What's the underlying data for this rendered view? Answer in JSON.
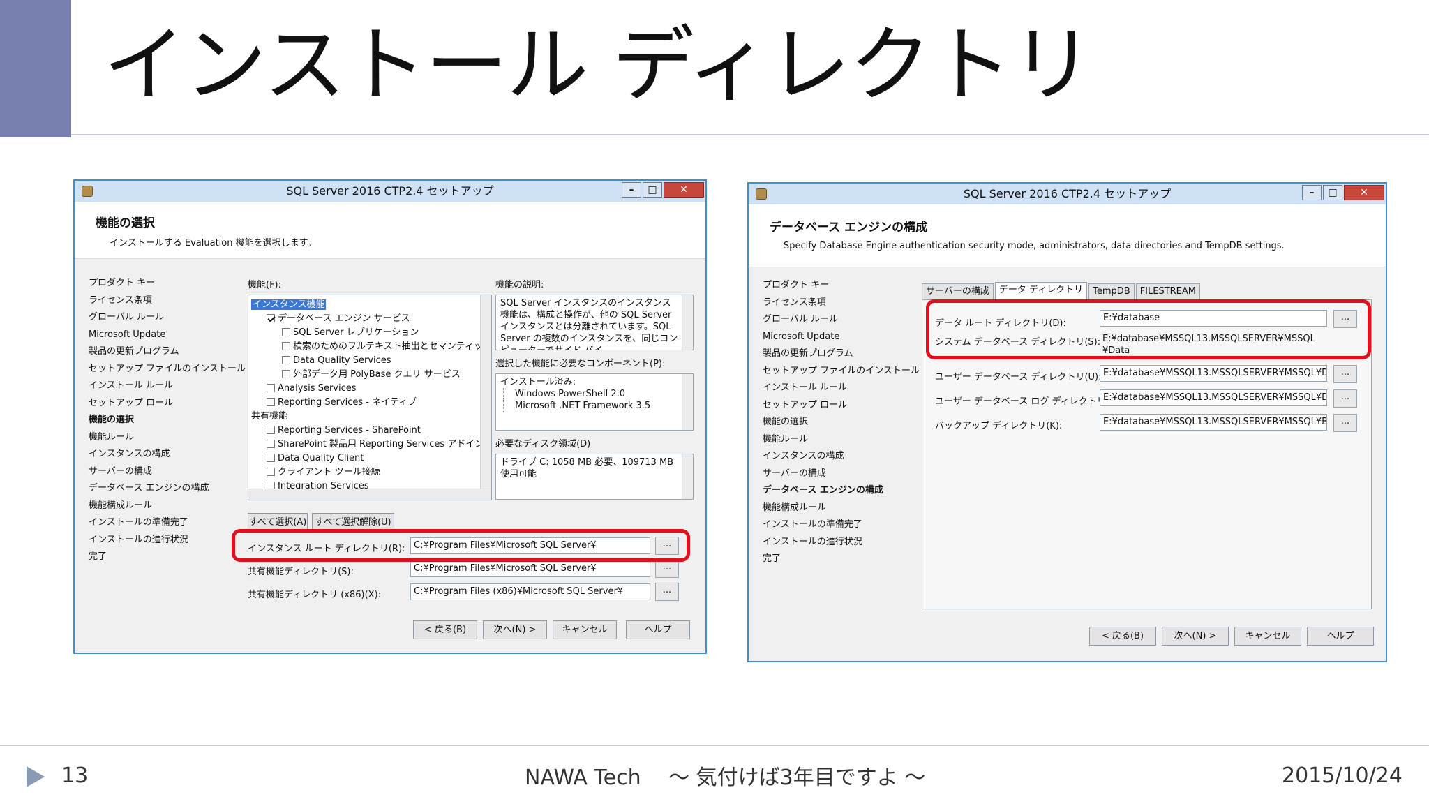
{
  "slide": {
    "title": "インストール ディレクトリ",
    "page_number": "13",
    "footer_center": "NAWA Tech　 ～ 気付けば3年目ですよ ～",
    "date": "2015/10/24",
    "accent_color": "#777fae",
    "highlight_color": "#e0101e"
  },
  "win1": {
    "title": "SQL Server 2016 CTP2.4 セットアップ",
    "header_title": "機能の選択",
    "header_sub": "インストールする Evaluation 機能を選択します。",
    "nav": [
      "プロダクト キー",
      "ライセンス条項",
      "グローバル ルール",
      "Microsoft Update",
      "製品の更新プログラム",
      "セットアップ ファイルのインストール",
      "インストール ルール",
      "セットアップ ロール",
      "機能の選択",
      "機能ルール",
      "インスタンスの構成",
      "サーバーの構成",
      "データベース エンジンの構成",
      "機能構成ルール",
      "インストールの準備完了",
      "インストールの進行状況",
      "完了"
    ],
    "nav_active": "機能の選択",
    "features_label": "機能(F):",
    "features": {
      "group1": "インスタンス機能",
      "db_engine": "データベース エンジン サービス",
      "replication": "SQL Server レプリケーション",
      "fulltext": "検索のためのフルテキスト抽出とセマンティック抽出",
      "dqs": "Data Quality Services",
      "polybase": "外部データ用 PolyBase クエリ サービス",
      "analysis": "Analysis Services",
      "reporting_native": "Reporting Services - ネイティブ",
      "group2": "共有機能",
      "reporting_sp": "Reporting Services - SharePoint",
      "sp_addin": "SharePoint 製品用 Reporting Services アドイン",
      "dq_client": "Data Quality Client",
      "client_tools": "クライアント ツール接続",
      "integration": "Integration Services"
    },
    "desc_label": "機能の説明:",
    "desc_text": "SQL Server インスタンスのインスタンス機能は、構成と操作が、他の SQL Server インスタンスとは分離されています。SQL Server の複数のインスタンスを、同じコンピューターでサイド バイ",
    "prereq_label": "選択した機能に必要なコンポーネント(P):",
    "prereq": [
      "インストール済み:",
      "Windows PowerShell 2.0",
      "Microsoft .NET Framework 3.5"
    ],
    "disk_label": "必要なディスク領域(D)",
    "disk_text": "ドライブ C: 1058 MB 必要、109713 MB 使用可能",
    "select_all": "すべて選択(A)",
    "unselect_all": "すべて選択解除(U)",
    "dirs": [
      {
        "label": "インスタンス ルート ディレクトリ(R):",
        "value": "C:¥Program Files¥Microsoft SQL Server¥"
      },
      {
        "label": "共有機能ディレクトリ(S):",
        "value": "C:¥Program Files¥Microsoft SQL Server¥"
      },
      {
        "label": "共有機能ディレクトリ (x86)(X):",
        "value": "C:¥Program Files (x86)¥Microsoft SQL Server¥"
      }
    ],
    "browse": "...",
    "buttons": {
      "back": "< 戻る(B)",
      "next": "次へ(N) >",
      "cancel": "キャンセル",
      "help": "ヘルプ"
    }
  },
  "win2": {
    "title": "SQL Server 2016 CTP2.4 セットアップ",
    "header_title": "データベース エンジンの構成",
    "header_sub": "Specify Database Engine authentication security mode, administrators, data directories and TempDB settings.",
    "nav": [
      "プロダクト キー",
      "ライセンス条項",
      "グローバル ルール",
      "Microsoft Update",
      "製品の更新プログラム",
      "セットアップ ファイルのインストール",
      "インストール ルール",
      "セットアップ ロール",
      "機能の選択",
      "機能ルール",
      "インスタンスの構成",
      "サーバーの構成",
      "データベース エンジンの構成",
      "機能構成ルール",
      "インストールの準備完了",
      "インストールの進行状況",
      "完了"
    ],
    "nav_active": "データベース エンジンの構成",
    "tabs": [
      "サーバーの構成",
      "データ ディレクトリ",
      "TempDB",
      "FILESTREAM"
    ],
    "active_tab": "データ ディレクトリ",
    "dirs": [
      {
        "label": "データ ルート ディレクトリ(D):",
        "value": "E:¥database"
      },
      {
        "label": "システム データベース ディレクトリ(S):",
        "value": "E:¥database¥MSSQL13.MSSQLSERVER¥MSSQL ¥Data"
      },
      {
        "label": "ユーザー データベース ディレクトリ(U):",
        "value": "E:¥database¥MSSQL13.MSSQLSERVER¥MSSQL¥D"
      },
      {
        "label": "ユーザー データベース ログ ディレクトリ(L):",
        "value": "E:¥database¥MSSQL13.MSSQLSERVER¥MSSQL¥D"
      },
      {
        "label": "バックアップ ディレクトリ(K):",
        "value": "E:¥database¥MSSQL13.MSSQLSERVER¥MSSQL¥B"
      }
    ],
    "browse": "...",
    "buttons": {
      "back": "< 戻る(B)",
      "next": "次へ(N) >",
      "cancel": "キャンセル",
      "help": "ヘルプ"
    }
  }
}
